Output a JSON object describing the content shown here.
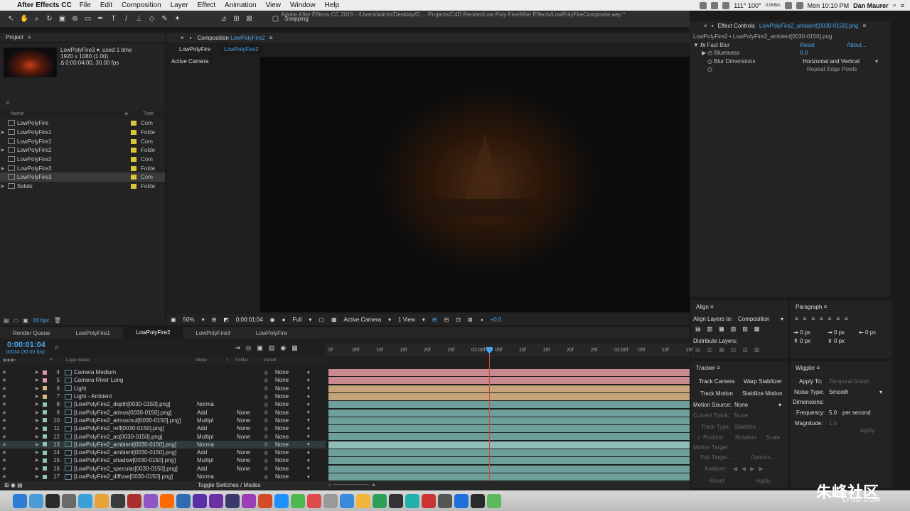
{
  "menubar": {
    "app": "After Effects CC",
    "items": [
      "File",
      "Edit",
      "Composition",
      "Layer",
      "Effect",
      "Animation",
      "View",
      "Window",
      "Help"
    ],
    "temps": "111° 100°",
    "net": "0.0KB/s",
    "clock": "Mon 10:10 PM",
    "user": "Dan Maurer"
  },
  "window_title": "Adobe After Effects CC 2015 - /Users/admin/Desktop/D ... Projects/C4D Render/Low Poly Fire/After Effects/LowPolyFireComposite.aep *",
  "toolbar": {
    "snapping": "Snapping"
  },
  "project": {
    "title": "Project",
    "selected_name": "LowPolyFire3 ▾",
    "used": ", used 1 time",
    "resolution": "1920 x 1080 (1.00)",
    "duration": "Δ 0;00:04:00, 30.00 fps",
    "col_name": "Name",
    "col_type": "Type",
    "items": [
      {
        "name": "LowPolyFire",
        "type": "Com"
      },
      {
        "name": "LowPolyFire1",
        "type": "Folde"
      },
      {
        "name": "LowPolyFire1",
        "type": "Com"
      },
      {
        "name": "LowPolyFire2",
        "type": "Folde"
      },
      {
        "name": "LowPolyFire2",
        "type": "Com"
      },
      {
        "name": "LowPolyFire3",
        "type": "Folde"
      },
      {
        "name": "LowPolyFire3",
        "type": "Com"
      },
      {
        "name": "Solids",
        "type": "Folde"
      }
    ],
    "bpc": "16 bpc"
  },
  "composition": {
    "panel_label": "Composition",
    "panel_name": "LowPolyFire2",
    "crumbs": [
      "LowPolyFire",
      "LowPolyFire2"
    ],
    "active_camera": "Active Camera",
    "zoom": "50%",
    "time": "0:00:01:04",
    "resolution": "Full",
    "camera_select": "Active Camera",
    "view": "1 View",
    "exposure": "+0.0"
  },
  "effect_controls": {
    "title": "Effect Controls",
    "layer": "LowPolyFire2_ambient[0030-0150].png",
    "path": "LowPolyFire2 • LowPolyFire2_ambient[0030-0150].png",
    "effect_name": "Fast Blur",
    "reset": "Reset",
    "about": "About...",
    "blurriness_label": "Blurriness",
    "blurriness_value": "6.0",
    "dimensions_label": "Blur Dimensions",
    "dimensions_value": "Horizontal and Vertical",
    "repeat_edge": "Repeat Edge Pixels"
  },
  "align": {
    "title": "Align",
    "align_to_label": "Align Layers to:",
    "align_to_value": "Composition",
    "distribute": "Distribute Layers:"
  },
  "paragraph": {
    "title": "Paragraph",
    "px": "0 px"
  },
  "tracker": {
    "title": "Tracker",
    "track_camera": "Track Camera",
    "warp_stabilizer": "Warp Stabilizer",
    "track_motion": "Track Motion",
    "stabilize_motion": "Stabilize Motion",
    "motion_source_label": "Motion Source:",
    "motion_source_value": "None",
    "current_track_label": "Current Track:",
    "current_track_value": "None",
    "track_type_label": "Track Type:",
    "track_type_value": "Stabilize",
    "position": "Position",
    "rotation": "Rotation",
    "scale": "Scale",
    "motion_target": "Motion Target:",
    "edit_target": "Edit Target...",
    "options": "Options...",
    "analyze": "Analyze:",
    "reset": "Reset",
    "apply": "Apply"
  },
  "wiggler": {
    "title": "Wiggler",
    "apply_to_label": "Apply To:",
    "apply_to_value": "Temporal Graph",
    "noise_label": "Noise Type:",
    "noise_value": "Smooth",
    "dimensions_label": "Dimensions:",
    "frequency_label": "Frequency:",
    "frequency_value": "5.0",
    "per_second": "per second",
    "magnitude_label": "Magnitude:",
    "magnitude_value": "1.0",
    "apply": "Apply"
  },
  "timeline": {
    "tabs": [
      "Render Queue",
      "LowPolyFire1",
      "LowPolyFire2",
      "LowPolyFire3",
      "LowPolyFire"
    ],
    "active_tab": 2,
    "timecode": "0:00:01:04",
    "frame": "00034 (30.00 fps)",
    "col_layer_name": "Layer Name",
    "col_mode": "Mode",
    "col_t": "T",
    "col_trkmat": "TrkMat",
    "col_parent": "Parent",
    "ruler": [
      "0f",
      "05f",
      "10f",
      "15f",
      "20f",
      "25f",
      "01:00f",
      "05f",
      "10f",
      "15f",
      "20f",
      "25f",
      "02:00f",
      "05f",
      "10f",
      "15f"
    ],
    "layers": [
      {
        "num": "4",
        "name": "Camera Medium",
        "mode": "",
        "trkmat": "",
        "parent": "None",
        "color": "#d79aa0",
        "bar": "#c88a8f"
      },
      {
        "num": "5",
        "name": "Camera River Long",
        "mode": "",
        "trkmat": "",
        "parent": "None",
        "color": "#d79aa0",
        "bar": "#c88a8f"
      },
      {
        "num": "6",
        "name": "Light",
        "mode": "",
        "trkmat": "",
        "parent": "None",
        "color": "#d8b48a",
        "bar": "#c7a57c"
      },
      {
        "num": "7",
        "name": "Light - Ambient",
        "mode": "",
        "trkmat": "",
        "parent": "None",
        "color": "#d8b48a",
        "bar": "#c7a57c"
      },
      {
        "num": "8",
        "name": "[LowPolyFire2_depth[0030-0150].png]",
        "mode": "Norma",
        "trkmat": "",
        "parent": "None",
        "color": "#8fc3bc",
        "bar": "#6f9f9a"
      },
      {
        "num": "9",
        "name": "[LowPolyFire2_atmos[0030-0150].png]",
        "mode": "Add",
        "trkmat": "None",
        "parent": "None",
        "color": "#8fc3bc",
        "bar": "#6f9f9a"
      },
      {
        "num": "10",
        "name": "[LowPolyFire2_atmosmul[0030-0150].png]",
        "mode": "Multipl",
        "trkmat": "None",
        "parent": "None",
        "color": "#8fc3bc",
        "bar": "#6f9f9a"
      },
      {
        "num": "11",
        "name": "[LowPolyFire2_refl[0030-0150].png]",
        "mode": "Add",
        "trkmat": "None",
        "parent": "None",
        "color": "#8fc3bc",
        "bar": "#6f9f9a"
      },
      {
        "num": "12",
        "name": "[LowPolyFire2_ao[0030-0150].png]",
        "mode": "Multipl",
        "trkmat": "None",
        "parent": "None",
        "color": "#8fc3bc",
        "bar": "#6f9f9a"
      },
      {
        "num": "13",
        "name": "[LowPolyFire2_ambient[0030-0150].png]",
        "mode": "Norma",
        "trkmat": "",
        "parent": "None",
        "color": "#8fc3bc",
        "bar": "#8fbdb7",
        "selected": true
      },
      {
        "num": "14",
        "name": "[LowPolyFire2_ambient[0030-0150].png]",
        "mode": "Add",
        "trkmat": "None",
        "parent": "None",
        "color": "#8fc3bc",
        "bar": "#6f9f9a"
      },
      {
        "num": "15",
        "name": "[LowPolyFire2_shadow[0030-0150].png]",
        "mode": "Multipl",
        "trkmat": "None",
        "parent": "None",
        "color": "#8fc3bc",
        "bar": "#6f9f9a"
      },
      {
        "num": "16",
        "name": "[LowPolyFire2_specular[0030-0150].png]",
        "mode": "Add",
        "trkmat": "None",
        "parent": "None",
        "color": "#8fc3bc",
        "bar": "#6f9f9a"
      },
      {
        "num": "17",
        "name": "[LowPolyFire2_diffuse[0030-0150].png]",
        "mode": "Norma",
        "trkmat": "",
        "parent": "None",
        "color": "#8fc3bc",
        "bar": "#6f9f9a"
      }
    ],
    "toggle": "Toggle Switches / Modes"
  },
  "watermark": {
    "main": "朱峰社区",
    "sub": "ZF3D.COM"
  }
}
